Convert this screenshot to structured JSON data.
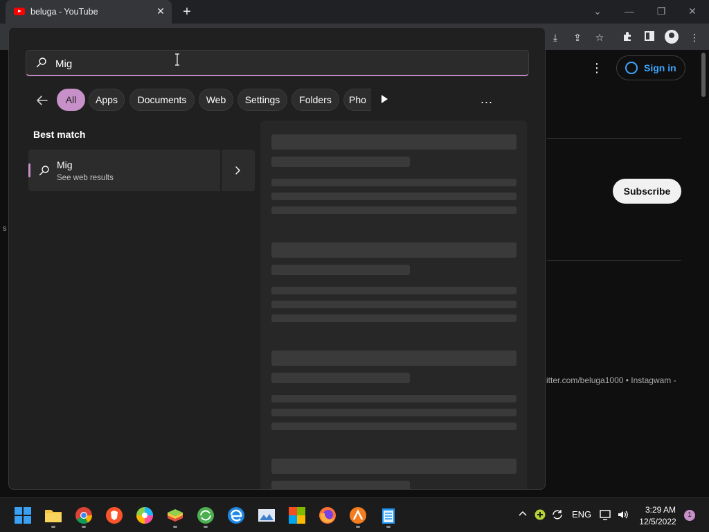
{
  "browser": {
    "tab_title": "beluga - YouTube",
    "tab_close": "✕",
    "new_tab": "+"
  },
  "youtube": {
    "sign_in": "Sign in",
    "subscribe": "Subscribe",
    "description_snippet": "itter.com/beluga1000 • Instagwam -",
    "side_fragment": "s"
  },
  "search_panel": {
    "query": "Mig",
    "filters": [
      "All",
      "Apps",
      "Documents",
      "Web",
      "Settings",
      "Folders",
      "Pho"
    ],
    "active_filter": "All",
    "more_label": "...",
    "best_match_heading": "Best match",
    "result": {
      "title": "Mig",
      "subtitle": "See web results"
    }
  },
  "taskbar": {
    "apps": [
      "start-icon",
      "file-explorer-icon",
      "chrome-icon",
      "brave-icon",
      "colorful-app-icon",
      "bluestacks-icon",
      "green-app-icon",
      "edge-icon",
      "image-viewer-icon",
      "office-app-icon",
      "firefox-icon",
      "orange-app-icon",
      "notepad-icon"
    ],
    "language": "ENG",
    "time": "3:29 AM",
    "date": "12/5/2022",
    "notification_count": "1"
  },
  "colors": {
    "accent": "#c790c8",
    "youtube_red": "#ff0000",
    "link_blue": "#3ea6ff"
  }
}
